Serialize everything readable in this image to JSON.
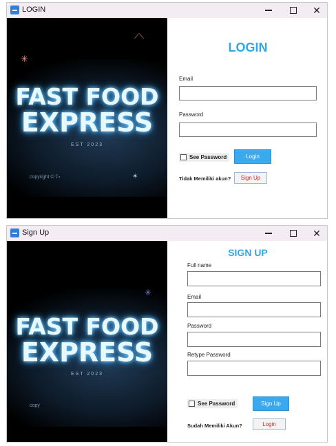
{
  "login_window": {
    "title": "LOGIN",
    "image": {
      "logo_line1": "FAST FOOD",
      "logo_line2": "EXPRESS",
      "est": "EST 2023",
      "copyright": "copyright © ʕ∘"
    },
    "form": {
      "heading": "LOGIN",
      "email_label": "Email",
      "email_value": "",
      "password_label": "Password",
      "password_value": "",
      "see_password_label": "See Password",
      "login_button": "Login",
      "no_account_prompt": "Tidak Memiliki akun?",
      "signup_button": "Sign Up"
    }
  },
  "signup_window": {
    "title": "Sign Up",
    "image": {
      "logo_line1": "FAST FOOD",
      "logo_line2": "EXPRESS",
      "est": "EST 2023",
      "copyright": "copy"
    },
    "form": {
      "heading": "SIGN UP",
      "fullname_label": "Full name",
      "fullname_value": "",
      "email_label": "Email",
      "email_value": "",
      "password_label": "Password",
      "password_value": "",
      "retype_label": "Retype Password",
      "retype_value": "",
      "see_password_label": "See Password",
      "signup_button": "Sign Up",
      "have_account_prompt": "Sudah Memiliki Akun?",
      "login_button": "Login"
    }
  },
  "colors": {
    "accent": "#33a6e8",
    "button_blue": "#3ba9ee",
    "secondary_text_red": "#e0202a",
    "titlebar": "#f3ecf3"
  },
  "icons": {
    "app": "app-icon",
    "minimize": "minimize-icon",
    "maximize": "maximize-icon",
    "close": "close-icon"
  }
}
